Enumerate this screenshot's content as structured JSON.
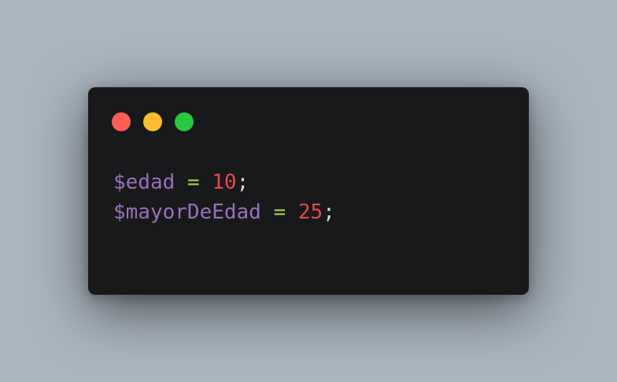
{
  "window": {
    "controls": [
      {
        "name": "close",
        "color": "#fe5d56"
      },
      {
        "name": "minimize",
        "color": "#fdbc2f"
      },
      {
        "name": "maximize",
        "color": "#28c840"
      }
    ]
  },
  "code": {
    "lines": [
      {
        "variable": "$edad",
        "space1": " ",
        "operator": "=",
        "space2": " ",
        "value": "10",
        "terminator": ";"
      },
      {
        "variable": "$mayorDeEdad",
        "space1": " ",
        "operator": "=",
        "space2": " ",
        "value": "25",
        "terminator": ";"
      }
    ]
  },
  "colors": {
    "background": "#a9b4bf",
    "window": "#18191b",
    "variable": "#9b6fb9",
    "operator": "#a6d34a",
    "number": "#e5484d",
    "punctuation": "#d6d7d9"
  }
}
